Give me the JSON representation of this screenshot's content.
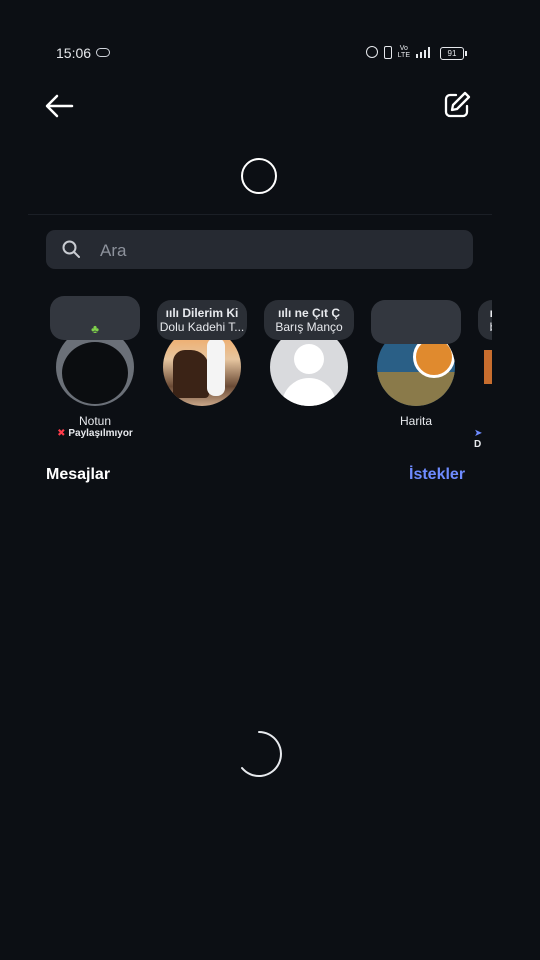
{
  "status_bar": {
    "time": "15:06",
    "icons": [
      "alarm-icon",
      "vibrate-icon",
      "volte-icon",
      "signal-icon"
    ],
    "battery": "91"
  },
  "header": {
    "back_icon": "arrow-left-icon",
    "compose_icon": "edit-square-icon"
  },
  "search": {
    "placeholder": "Ara"
  },
  "notes": [
    {
      "kind": "own-note",
      "name": "Notun",
      "sub": "Paylaşılmıyor",
      "bubble_line1": "",
      "bubble_line2": ""
    },
    {
      "kind": "music-note",
      "name": "",
      "sub": "",
      "bubble_line1": "Dilerim Ki",
      "bubble_line2": "Dolu Kadehi T..."
    },
    {
      "kind": "music-note",
      "name": "",
      "sub": "",
      "bubble_line1": "ne      Çıt Ç",
      "bubble_line2": "Barış Manço"
    },
    {
      "kind": "map-note",
      "name": "Harita",
      "sub": "",
      "bubble_line1": "",
      "bubble_line2": ""
    },
    {
      "kind": "partial",
      "name": "",
      "sub": "D",
      "bubble_line1": "",
      "bubble_line2": "b"
    }
  ],
  "messages": {
    "title": "Mesajlar",
    "requests_label": "İstekler"
  },
  "colors": {
    "background": "#0c0f14",
    "search_bg": "#262a32",
    "accent": "#6e8bff",
    "text": "#ffffff"
  }
}
